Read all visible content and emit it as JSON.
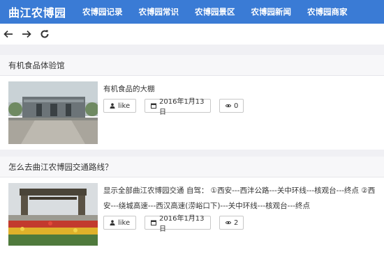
{
  "navbar": {
    "brand": "曲江农博园",
    "items": [
      {
        "label": "农博园记录"
      },
      {
        "label": "农博园常识"
      },
      {
        "label": "农博园景区"
      },
      {
        "label": "农博园新闻"
      },
      {
        "label": "农博园商家"
      }
    ],
    "color": "#3a7bd5"
  },
  "toolbar": {
    "icons": [
      "arrow-left-icon",
      "arrow-right-icon",
      "refresh-icon"
    ]
  },
  "articles": [
    {
      "title": "有机食品体验馆",
      "description": "有机食品的大棚",
      "like_label": "like",
      "date": "2016年1月13日",
      "views": "0"
    },
    {
      "title": "怎么去曲江农博园交通路线？",
      "description": "显示全部曲江农博园交通 自驾： ①西安---西沣公路---关中环线---核观台---终点 ②西安---绕城高速---西汉高速(涝峪口下)---关中环线---核观台---终点",
      "like_label": "like",
      "date": "2016年1月13日",
      "views": "2"
    }
  ]
}
